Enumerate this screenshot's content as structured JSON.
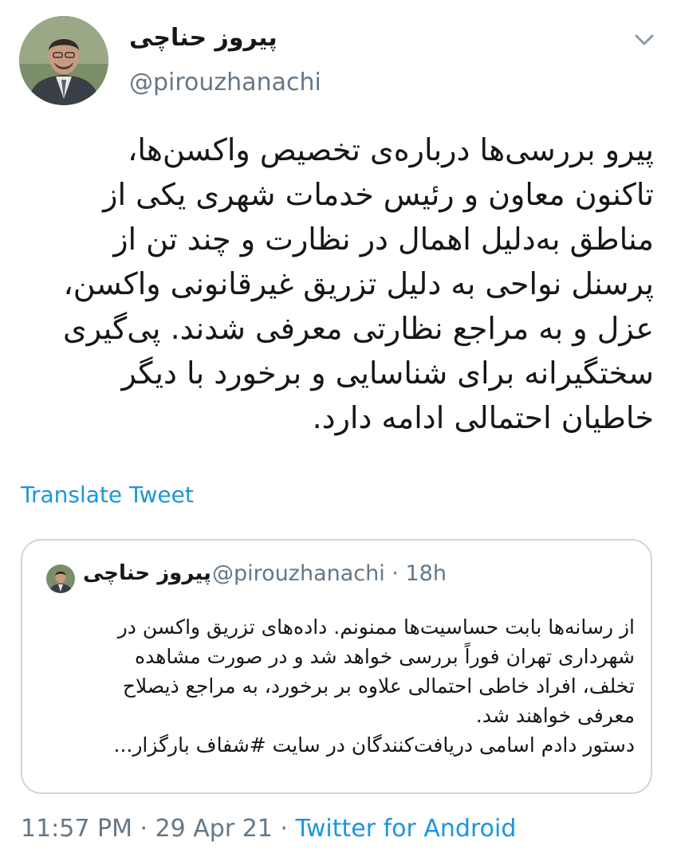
{
  "author": {
    "name": "پیروز حناچی",
    "handle": "@pirouzhanachi"
  },
  "tweet": {
    "lines": [
      "پیرو بررسی‌ها درباره‌ی تخصیص واکسن‌ها،",
      "تاکنون معاون و رئیس خدمات شهری یکی از",
      "مناطق به‌دلیل اهمال در نظارت و چند تن از",
      "پرسنل نواحی به دلیل تزریق غیرقانونی واکسن،",
      "عزل و به مراجع نظارتی معرفی شدند. پی‌گیری",
      "سختگیرانه برای شناسایی و برخورد با دیگر",
      "خاطیان احتمالی ادامه دارد."
    ]
  },
  "translate_label": "Translate Tweet",
  "quoted": {
    "name": "پیروز حناچی",
    "handle_time": "@pirouzhanachi · 18h",
    "lines": [
      "از رسانه‌ها بابت حساسیت‌ها ممنونم. داده‌های تزریق واکسن در",
      "شهرداری تهران فوراً بررسی خواهد شد و در صورت مشاهده",
      "تخلف، افراد خاطی احتمالی علاوه بر برخورد، به مراجع ذیصلاح",
      "معرفی خواهند شد.",
      "دستور دادم اسامی دریافت‌کنندگان در سایت #شفاف بارگزار..."
    ]
  },
  "footer": {
    "datetime": "11:57 PM · 29 Apr 21 · ",
    "app": "Twitter for Android"
  },
  "icons": {
    "menu": "chevron-down-icon"
  },
  "colors": {
    "link": "#1b95e0",
    "secondary": "#657786",
    "border": "#ccd6dd"
  }
}
